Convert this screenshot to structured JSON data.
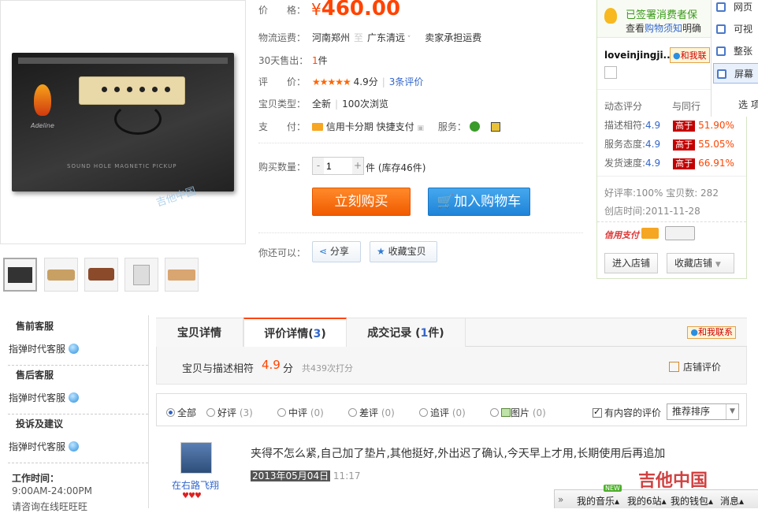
{
  "product": {
    "price_label": "价　　格：",
    "price_symbol": "¥",
    "price": "460.00",
    "shipping_label": "物流运费：",
    "shipping_from": "河南郑州",
    "shipping_sep": "至",
    "shipping_to": "广东清远",
    "shipping_fee": "卖家承担运费",
    "sold_label": "30天售出：",
    "sold_count": "1",
    "sold_unit": "件",
    "rating_label": "评　　价：",
    "rating_stars": "★★★★★",
    "rating_score": "4.9分",
    "rating_reviews": "3条评价",
    "type_label": "宝贝类型：",
    "type_value": "全新",
    "views": "100次浏览",
    "pay_label": "支　　付：",
    "pay_card": "信用卡分期",
    "pay_quick": "快捷支付",
    "service_label": "服务：",
    "qty_label": "购买数量：",
    "qty_value": "1",
    "qty_minus": "-",
    "qty_plus": "+",
    "qty_unit": "件",
    "stock": "(库存46件)",
    "buy_now": "立刻购买",
    "add_cart": "加入购物车",
    "also_label": "你还可以：",
    "share": "分享",
    "favorite": "收藏宝贝",
    "watermark": "吉他中国"
  },
  "shop": {
    "guarantee": "已签署消费者保",
    "notice_pre": "查看",
    "notice_link": "购物须知",
    "notice_post": "明确",
    "seller": "loveinjingji...",
    "contact": "和我联",
    "dyn_label": "动态评分",
    "compare_label": "与同行",
    "scores": [
      {
        "label": "描述相符:",
        "value": "4.9",
        "tag": "高于",
        "pct": "51.90%"
      },
      {
        "label": "服务态度:",
        "value": "4.9",
        "tag": "高于",
        "pct": "55.05%"
      },
      {
        "label": "发货速度:",
        "value": "4.9",
        "tag": "高于",
        "pct": "66.91%"
      }
    ],
    "good_rate": "好评率:100%",
    "items_count": "宝贝数: 282",
    "created": "创店时间:2011-11-28",
    "credit": "信用支付",
    "enter": "进入店铺",
    "fav_shop": "收藏店铺"
  },
  "floating_menu": {
    "items": [
      "网页",
      "可视",
      "整张",
      "屏幕"
    ],
    "options": "选 项"
  },
  "service": {
    "pre_title": "售前客服",
    "pre_item": "指弹时代客服",
    "post_title": "售后客服",
    "post_item": "指弹时代客服",
    "complaint_title": "投诉及建议",
    "complaint_item": "指弹时代客服",
    "hours_title": "工作时间：",
    "hours": "9:00AM-24:00PM",
    "hours_note": "请咨询在线旺旺旺"
  },
  "tabs": {
    "detail": "宝贝详情",
    "reviews_pre": "评价详情(",
    "reviews_count": "3",
    "reviews_post": ")",
    "deals_pre": "成交记录 (",
    "deals_count": "1",
    "deals_post": "件)",
    "contact": "和我联系"
  },
  "score_bar": {
    "label": "宝贝与描述相符",
    "score": "4.9",
    "unit": "分",
    "count": "共439次打分",
    "shop_reviews": "店铺评价"
  },
  "filters": [
    {
      "label": "全部",
      "count": ""
    },
    {
      "label": "好评",
      "count": "(3)"
    },
    {
      "label": "中评",
      "count": "(0)"
    },
    {
      "label": "差评",
      "count": "(0)"
    },
    {
      "label": "追评",
      "count": "(0)"
    },
    {
      "label": "图片",
      "count": "(0)"
    }
  ],
  "filter_content": "有内容的评价",
  "sort": "推荐排序",
  "review": {
    "user": "在右路飞翔",
    "text": "夹得不怎么紧,自己加了垫片,其他挺好,外出迟了确认,今天早上才用,长期使用后再追加",
    "date": "2013年05月04日",
    "time": "11:17"
  },
  "bottom_bar": {
    "arrow": "»",
    "music": "我的音乐",
    "site": "我的6站",
    "wallet": "我的钱包",
    "more": "消息",
    "new_badge": "NEW"
  },
  "colors": {
    "accent": "#ff4400",
    "link": "#3366cc",
    "buy": "#f15a00",
    "cart": "#1f83d8"
  }
}
